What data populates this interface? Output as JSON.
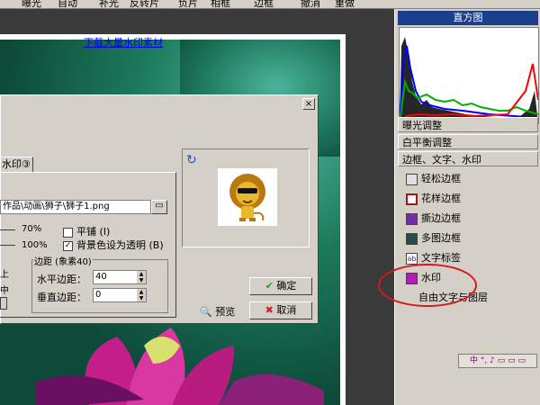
{
  "toolbar": {
    "items": [
      "曝光",
      "自动",
      "补光",
      "反转片",
      "负片",
      "相框",
      "边框",
      "撤消",
      "重做"
    ]
  },
  "right_panel": {
    "title": "直方图",
    "sections": [
      "曝光调整",
      "白平衡调整",
      "边框、文字、水印"
    ],
    "tools": [
      "轻松边框",
      "花样边框",
      "撕边边框",
      "多图边框",
      "文字标签",
      "水印",
      "自由文字与图层"
    ],
    "mini_tools_label": "中 °, ♪ ▭ ▭ ▭"
  },
  "dialog": {
    "close_label": "×",
    "download_link": "下载大量水印素材",
    "tab_label": "水印③",
    "file_path": "作品\\动画\\狮子\\狮子1.png",
    "opacity_label": "70%",
    "size_label": "100%",
    "tile_label": "平铺 (I)",
    "transparent_label": "背景色设为透明 (B)",
    "transparent_checked": "✓",
    "margin_group": "边距 (象素40)",
    "h_margin_label": "水平边距：",
    "h_margin_value": "40",
    "v_margin_label": "垂直边距：",
    "v_margin_value": "0",
    "left_edge_1": "上",
    "left_edge_2": "中",
    "preview_label": "预览",
    "ok_label": "确定",
    "cancel_label": "取消"
  },
  "colors": {
    "panel_title_bg": "#1a3f8c",
    "link": "#0000ee",
    "annotation": "#d81818"
  }
}
